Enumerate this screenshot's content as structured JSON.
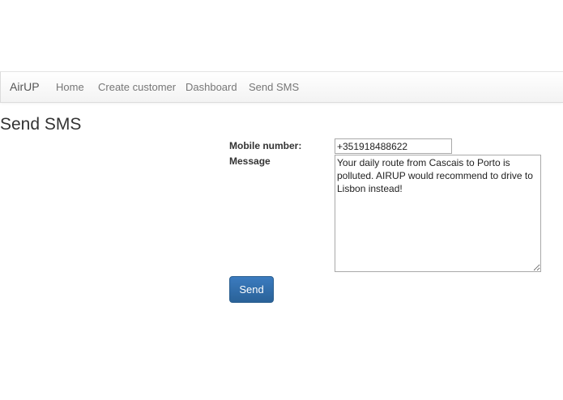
{
  "navbar": {
    "brand": "AirUP",
    "links": [
      {
        "label": "Home"
      },
      {
        "label": "Create customer"
      },
      {
        "label": "Dashboard"
      },
      {
        "label": "Send SMS"
      }
    ]
  },
  "page": {
    "title": "Send SMS"
  },
  "form": {
    "mobile_label": "Mobile number:",
    "mobile_value": "+351918488622",
    "message_label": "Message",
    "message_value": "Your daily route from Cascais to Porto is polluted. AIRUP would recommend to drive to Lisbon instead!",
    "send_label": "Send"
  },
  "colors": {
    "primary_button": "#2a6298",
    "navbar_bg": "#f8f8f8"
  }
}
